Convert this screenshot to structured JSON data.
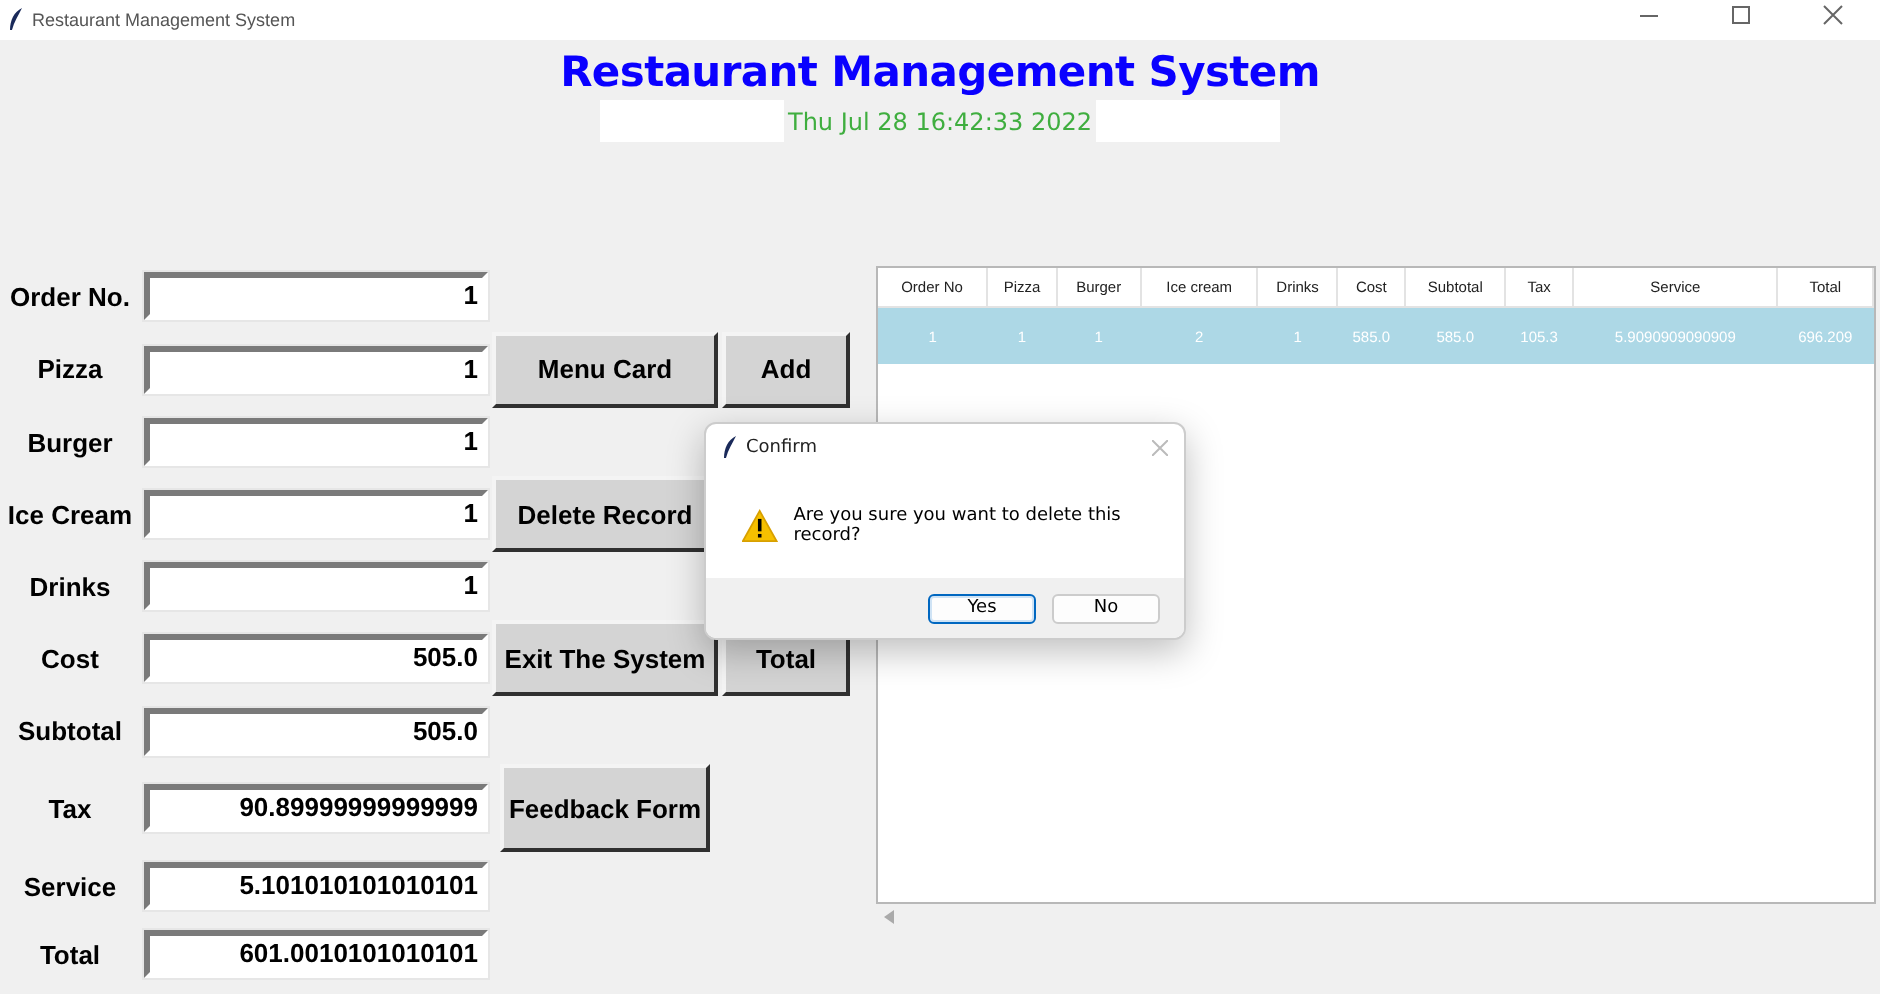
{
  "window": {
    "title": "Restaurant Management System"
  },
  "header": {
    "title": "Restaurant Management System",
    "clock": "Thu Jul 28 16:42:33 2022"
  },
  "fields": [
    {
      "label": "Order No.",
      "value": "1"
    },
    {
      "label": "Pizza",
      "value": "1"
    },
    {
      "label": "Burger",
      "value": "1"
    },
    {
      "label": "Ice Cream",
      "value": "1"
    },
    {
      "label": "Drinks",
      "value": "1"
    },
    {
      "label": "Cost",
      "value": "505.0"
    },
    {
      "label": "Subtotal",
      "value": "505.0"
    },
    {
      "label": "Tax",
      "value": "90.89999999999999"
    },
    {
      "label": "Service",
      "value": "5.101010101010101"
    },
    {
      "label": "Total",
      "value": "601.0010101010101"
    }
  ],
  "buttons": [
    {
      "label": "Menu Card"
    },
    {
      "label": "Add"
    },
    {
      "label": "Delete Record"
    },
    {
      "label": "Exit The System"
    },
    {
      "label": "Total"
    },
    {
      "label": "Feedback Form"
    }
  ],
  "table": {
    "columns": [
      "Order No",
      "Pizza",
      "Burger",
      "Ice cream",
      "Drinks",
      "Cost",
      "Subtotal",
      "Tax",
      "Service",
      "Total"
    ],
    "rows": [
      {
        "selected": true,
        "cells": [
          "1",
          "1",
          "1",
          "2",
          "1",
          "585.0",
          "585.0",
          "105.3",
          "5.9090909090909",
          "696.209"
        ]
      }
    ]
  },
  "dialog": {
    "title": "Confirm",
    "message": "Are you sure you want to delete this record?",
    "buttons": [
      {
        "label": "Yes",
        "focused": true
      },
      {
        "label": "No",
        "focused": false
      }
    ]
  }
}
